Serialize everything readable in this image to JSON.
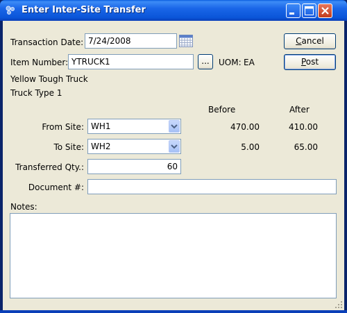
{
  "window": {
    "title": "Enter Inter-Site Transfer"
  },
  "form": {
    "transaction_date_label": "Transaction Date:",
    "transaction_date_value": "7/24/2008",
    "item_number_label": "Item Number:",
    "item_number_value": "YTRUCK1",
    "lookup_button_label": "...",
    "uom_label": "UOM:",
    "uom_value": "EA",
    "description1": "Yellow Tough Truck",
    "description2": "Truck Type 1",
    "before_header": "Before",
    "after_header": "After",
    "from_site_label": "From Site:",
    "from_site_value": "WH1",
    "from_before": "470.00",
    "from_after": "410.00",
    "to_site_label": "To Site:",
    "to_site_value": "WH2",
    "to_before": "5.00",
    "to_after": "65.00",
    "qty_label": "Transferred Qty.:",
    "qty_value": "60",
    "document_label": "Document #:",
    "document_value": "",
    "notes_label": "Notes:",
    "notes_value": ""
  },
  "buttons": {
    "cancel_label_pre": "",
    "cancel_label_u": "C",
    "cancel_label_post": "ancel",
    "post_label_pre": "",
    "post_label_u": "P",
    "post_label_post": "ost"
  },
  "icons": {
    "app": "app-icon",
    "calendar": "calendar-icon",
    "minimize": "minimize-icon",
    "maximize": "maximize-icon",
    "close": "close-icon",
    "dropdown": "chevron-down-icon",
    "grip": "resize-grip-icon"
  },
  "colors": {
    "titlebar": "#0a5fe0",
    "dialog_bg": "#ece9d8",
    "field_border": "#7f9db9"
  }
}
